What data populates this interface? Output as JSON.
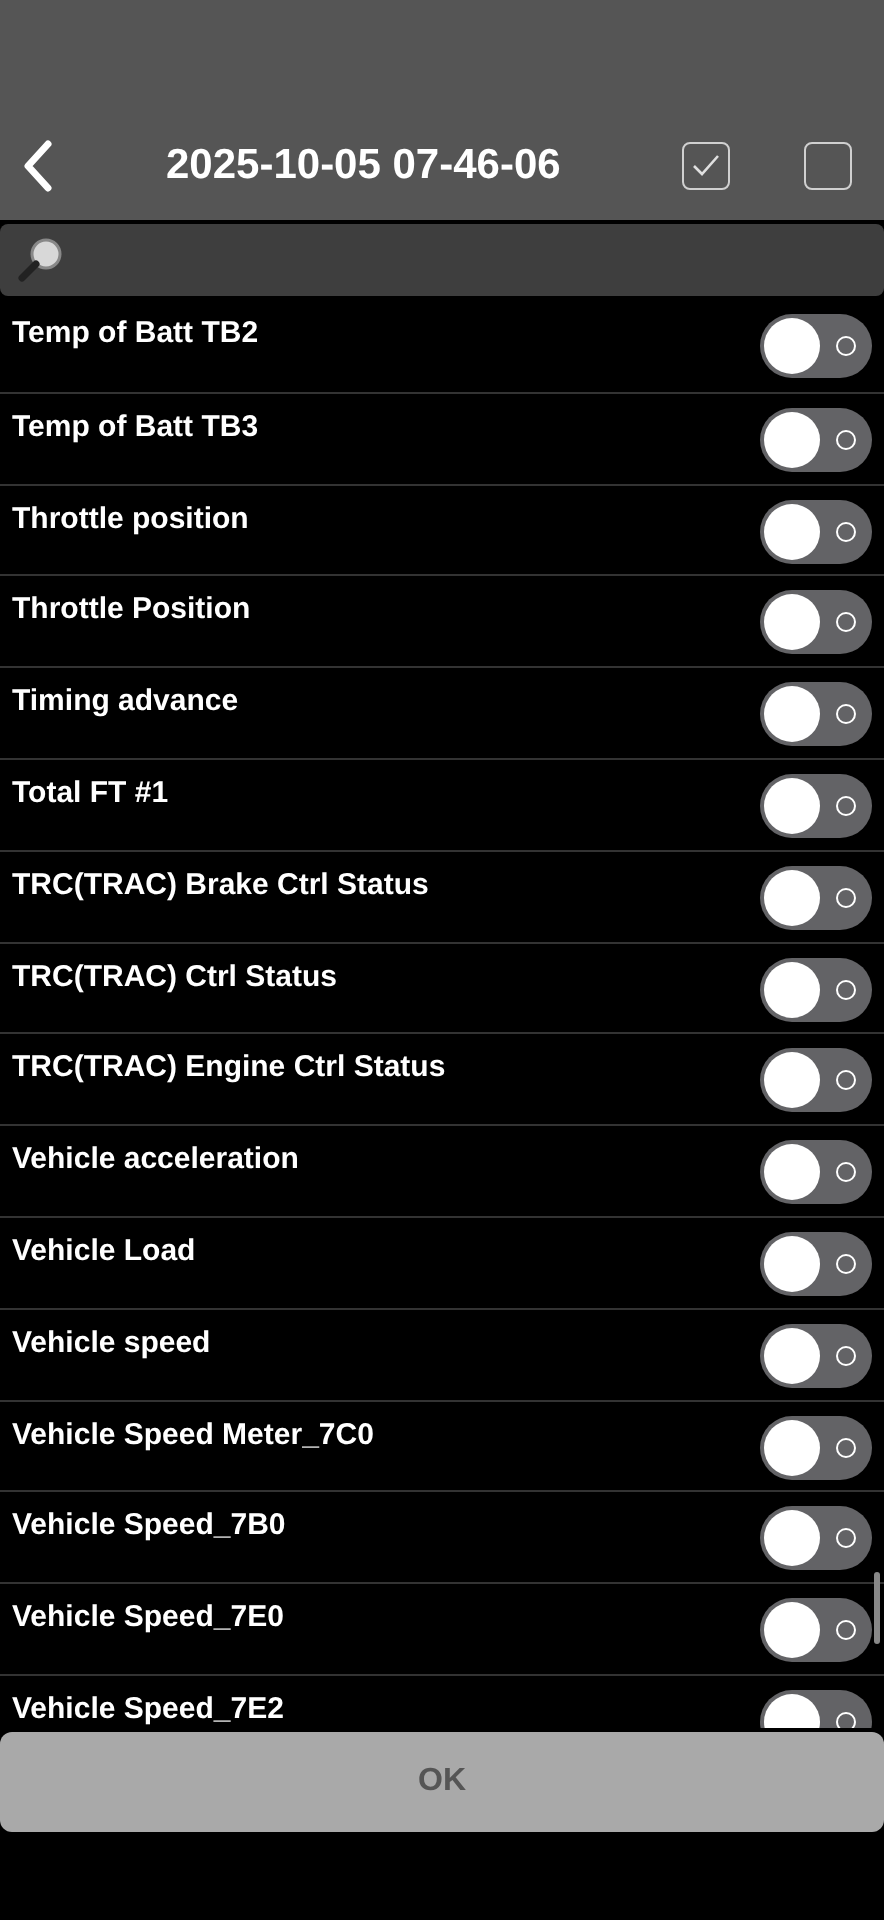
{
  "header": {
    "title": "2025-10-05 07-46-06",
    "select_all": {
      "checked": true
    },
    "select_none": {
      "checked": false
    }
  },
  "items": [
    {
      "label": "Temp of Batt TB2",
      "on": false
    },
    {
      "label": "Temp of Batt TB3",
      "on": false
    },
    {
      "label": "Throttle position",
      "on": false
    },
    {
      "label": "Throttle Position",
      "on": false
    },
    {
      "label": "Timing advance",
      "on": false
    },
    {
      "label": "Total FT #1",
      "on": false
    },
    {
      "label": "TRC(TRAC) Brake Ctrl Status",
      "on": false
    },
    {
      "label": "TRC(TRAC) Ctrl Status",
      "on": false
    },
    {
      "label": "TRC(TRAC) Engine Ctrl Status",
      "on": false
    },
    {
      "label": "Vehicle acceleration",
      "on": false
    },
    {
      "label": "Vehicle Load",
      "on": false
    },
    {
      "label": "Vehicle speed",
      "on": false
    },
    {
      "label": "Vehicle Speed Meter_7C0",
      "on": false
    },
    {
      "label": "Vehicle Speed_7B0",
      "on": false
    },
    {
      "label": "Vehicle Speed_7E0",
      "on": false
    },
    {
      "label": "Vehicle Speed_7E2",
      "on": false
    }
  ],
  "ok_button": {
    "label": "OK",
    "disabled": true
  }
}
